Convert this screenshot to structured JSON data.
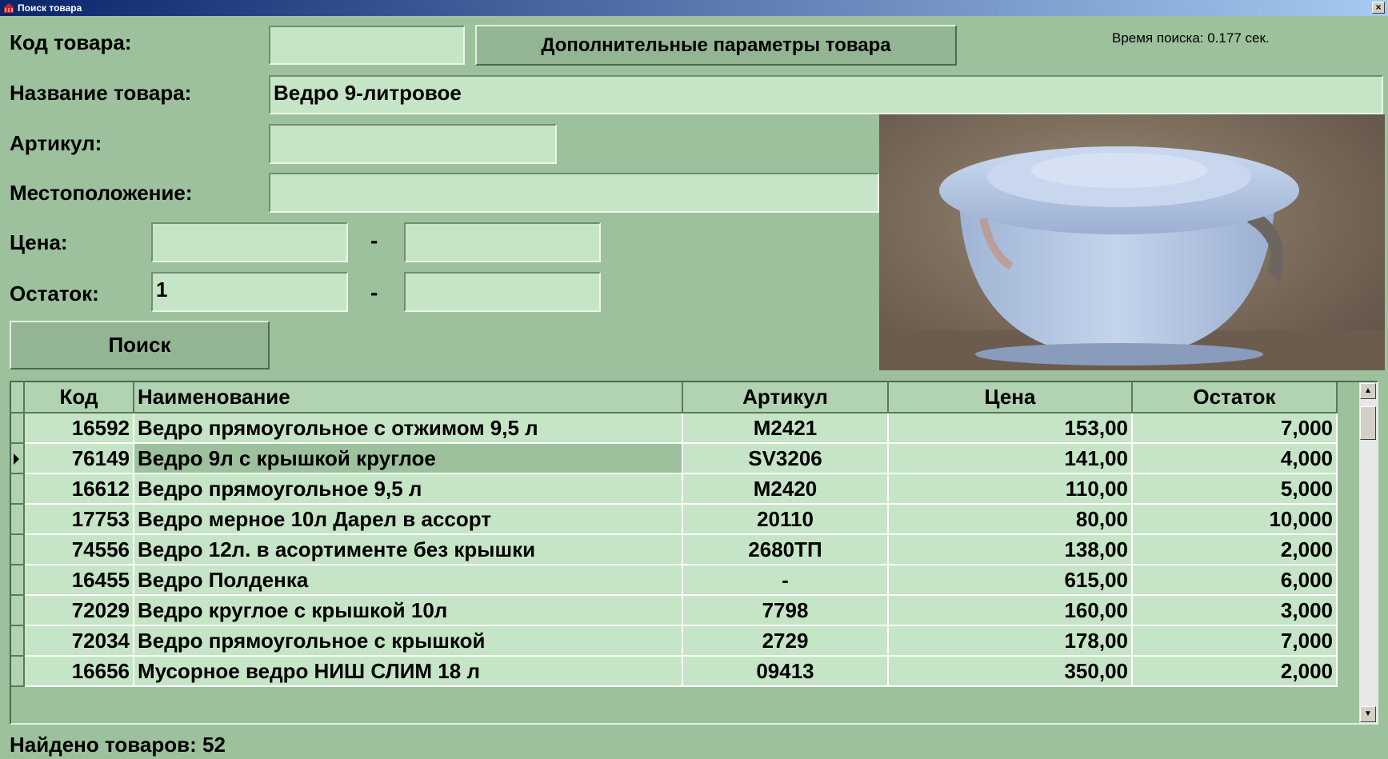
{
  "window": {
    "title": "Поиск товара",
    "close_glyph": "×"
  },
  "form": {
    "code_label": "Код товара:",
    "code_value": "",
    "extra_params_button": "Дополнительные параметры товара",
    "search_time": "Время поиска: 0.177 сек.",
    "name_label": "Название товара:",
    "name_value": "Ведро 9-литровое",
    "article_label": "Артикул:",
    "article_value": "",
    "location_label": "Местоположение:",
    "location_value": "",
    "price_label": "Цена:",
    "price_from": "",
    "price_to": "",
    "stock_label": "Остаток:",
    "stock_from": "1",
    "stock_to": "",
    "range_dash": "-",
    "search_button": "Поиск"
  },
  "grid": {
    "columns": [
      "Код",
      "Наименование",
      "Артикул",
      "Цена",
      "Остаток"
    ],
    "rows": [
      {
        "code": "16592",
        "name": "Ведро прямоугольное с отжимом 9,5 л",
        "article": "M2421",
        "price": "153,00",
        "stock": "7,000"
      },
      {
        "code": "76149",
        "name": "Ведро 9л с крышкой круглое",
        "article": "SV3206",
        "price": "141,00",
        "stock": "4,000"
      },
      {
        "code": "16612",
        "name": "Ведро прямоугольное 9,5 л",
        "article": "M2420",
        "price": "110,00",
        "stock": "5,000"
      },
      {
        "code": "17753",
        "name": "Ведро мерное 10л Дарел в ассорт",
        "article": "20110",
        "price": "80,00",
        "stock": "10,000"
      },
      {
        "code": "74556",
        "name": "Ведро 12л. в асортименте без крышки",
        "article": "2680ТП",
        "price": "138,00",
        "stock": "2,000"
      },
      {
        "code": "16455",
        "name": "Ведро Полденка",
        "article": "-",
        "price": "615,00",
        "stock": "6,000"
      },
      {
        "code": "72029",
        "name": "Ведро круглое с крышкой 10л",
        "article": "7798",
        "price": "160,00",
        "stock": "3,000"
      },
      {
        "code": "72034",
        "name": "Ведро прямоугольное с крышкой",
        "article": "2729",
        "price": "178,00",
        "stock": "7,000"
      },
      {
        "code": "16656",
        "name": "Мусорное ведро НИШ СЛИМ 18 л",
        "article": "09413",
        "price": "350,00",
        "stock": "2,000"
      }
    ],
    "selected_row": 1
  },
  "status": {
    "found_text": "Найдено товаров: 52"
  },
  "colors": {
    "background": "#9dc19d",
    "field": "#c6e4c6",
    "button": "#93b593",
    "header": "#b1d3b1"
  },
  "icons": {
    "app": "basket-icon",
    "scroll_up": "arrow-up-icon",
    "scroll_down": "arrow-down-icon"
  }
}
